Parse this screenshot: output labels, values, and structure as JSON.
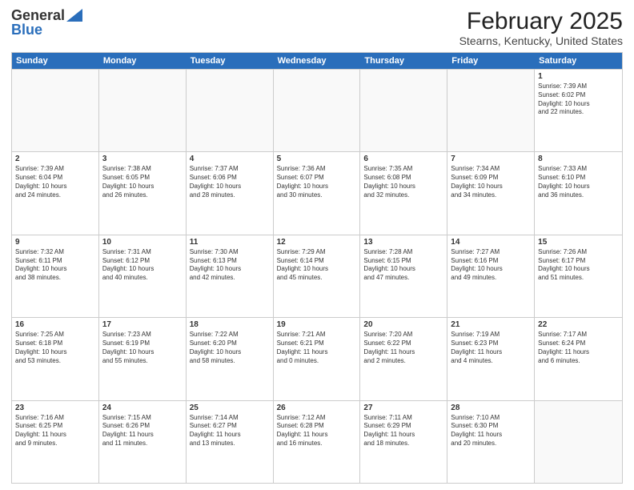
{
  "header": {
    "logo_general": "General",
    "logo_blue": "Blue",
    "month_title": "February 2025",
    "location": "Stearns, Kentucky, United States"
  },
  "weekdays": [
    "Sunday",
    "Monday",
    "Tuesday",
    "Wednesday",
    "Thursday",
    "Friday",
    "Saturday"
  ],
  "weeks": [
    [
      {
        "day": "",
        "info": ""
      },
      {
        "day": "",
        "info": ""
      },
      {
        "day": "",
        "info": ""
      },
      {
        "day": "",
        "info": ""
      },
      {
        "day": "",
        "info": ""
      },
      {
        "day": "",
        "info": ""
      },
      {
        "day": "1",
        "info": "Sunrise: 7:39 AM\nSunset: 6:02 PM\nDaylight: 10 hours\nand 22 minutes."
      }
    ],
    [
      {
        "day": "2",
        "info": "Sunrise: 7:39 AM\nSunset: 6:04 PM\nDaylight: 10 hours\nand 24 minutes."
      },
      {
        "day": "3",
        "info": "Sunrise: 7:38 AM\nSunset: 6:05 PM\nDaylight: 10 hours\nand 26 minutes."
      },
      {
        "day": "4",
        "info": "Sunrise: 7:37 AM\nSunset: 6:06 PM\nDaylight: 10 hours\nand 28 minutes."
      },
      {
        "day": "5",
        "info": "Sunrise: 7:36 AM\nSunset: 6:07 PM\nDaylight: 10 hours\nand 30 minutes."
      },
      {
        "day": "6",
        "info": "Sunrise: 7:35 AM\nSunset: 6:08 PM\nDaylight: 10 hours\nand 32 minutes."
      },
      {
        "day": "7",
        "info": "Sunrise: 7:34 AM\nSunset: 6:09 PM\nDaylight: 10 hours\nand 34 minutes."
      },
      {
        "day": "8",
        "info": "Sunrise: 7:33 AM\nSunset: 6:10 PM\nDaylight: 10 hours\nand 36 minutes."
      }
    ],
    [
      {
        "day": "9",
        "info": "Sunrise: 7:32 AM\nSunset: 6:11 PM\nDaylight: 10 hours\nand 38 minutes."
      },
      {
        "day": "10",
        "info": "Sunrise: 7:31 AM\nSunset: 6:12 PM\nDaylight: 10 hours\nand 40 minutes."
      },
      {
        "day": "11",
        "info": "Sunrise: 7:30 AM\nSunset: 6:13 PM\nDaylight: 10 hours\nand 42 minutes."
      },
      {
        "day": "12",
        "info": "Sunrise: 7:29 AM\nSunset: 6:14 PM\nDaylight: 10 hours\nand 45 minutes."
      },
      {
        "day": "13",
        "info": "Sunrise: 7:28 AM\nSunset: 6:15 PM\nDaylight: 10 hours\nand 47 minutes."
      },
      {
        "day": "14",
        "info": "Sunrise: 7:27 AM\nSunset: 6:16 PM\nDaylight: 10 hours\nand 49 minutes."
      },
      {
        "day": "15",
        "info": "Sunrise: 7:26 AM\nSunset: 6:17 PM\nDaylight: 10 hours\nand 51 minutes."
      }
    ],
    [
      {
        "day": "16",
        "info": "Sunrise: 7:25 AM\nSunset: 6:18 PM\nDaylight: 10 hours\nand 53 minutes."
      },
      {
        "day": "17",
        "info": "Sunrise: 7:23 AM\nSunset: 6:19 PM\nDaylight: 10 hours\nand 55 minutes."
      },
      {
        "day": "18",
        "info": "Sunrise: 7:22 AM\nSunset: 6:20 PM\nDaylight: 10 hours\nand 58 minutes."
      },
      {
        "day": "19",
        "info": "Sunrise: 7:21 AM\nSunset: 6:21 PM\nDaylight: 11 hours\nand 0 minutes."
      },
      {
        "day": "20",
        "info": "Sunrise: 7:20 AM\nSunset: 6:22 PM\nDaylight: 11 hours\nand 2 minutes."
      },
      {
        "day": "21",
        "info": "Sunrise: 7:19 AM\nSunset: 6:23 PM\nDaylight: 11 hours\nand 4 minutes."
      },
      {
        "day": "22",
        "info": "Sunrise: 7:17 AM\nSunset: 6:24 PM\nDaylight: 11 hours\nand 6 minutes."
      }
    ],
    [
      {
        "day": "23",
        "info": "Sunrise: 7:16 AM\nSunset: 6:25 PM\nDaylight: 11 hours\nand 9 minutes."
      },
      {
        "day": "24",
        "info": "Sunrise: 7:15 AM\nSunset: 6:26 PM\nDaylight: 11 hours\nand 11 minutes."
      },
      {
        "day": "25",
        "info": "Sunrise: 7:14 AM\nSunset: 6:27 PM\nDaylight: 11 hours\nand 13 minutes."
      },
      {
        "day": "26",
        "info": "Sunrise: 7:12 AM\nSunset: 6:28 PM\nDaylight: 11 hours\nand 16 minutes."
      },
      {
        "day": "27",
        "info": "Sunrise: 7:11 AM\nSunset: 6:29 PM\nDaylight: 11 hours\nand 18 minutes."
      },
      {
        "day": "28",
        "info": "Sunrise: 7:10 AM\nSunset: 6:30 PM\nDaylight: 11 hours\nand 20 minutes."
      },
      {
        "day": "",
        "info": ""
      }
    ]
  ]
}
